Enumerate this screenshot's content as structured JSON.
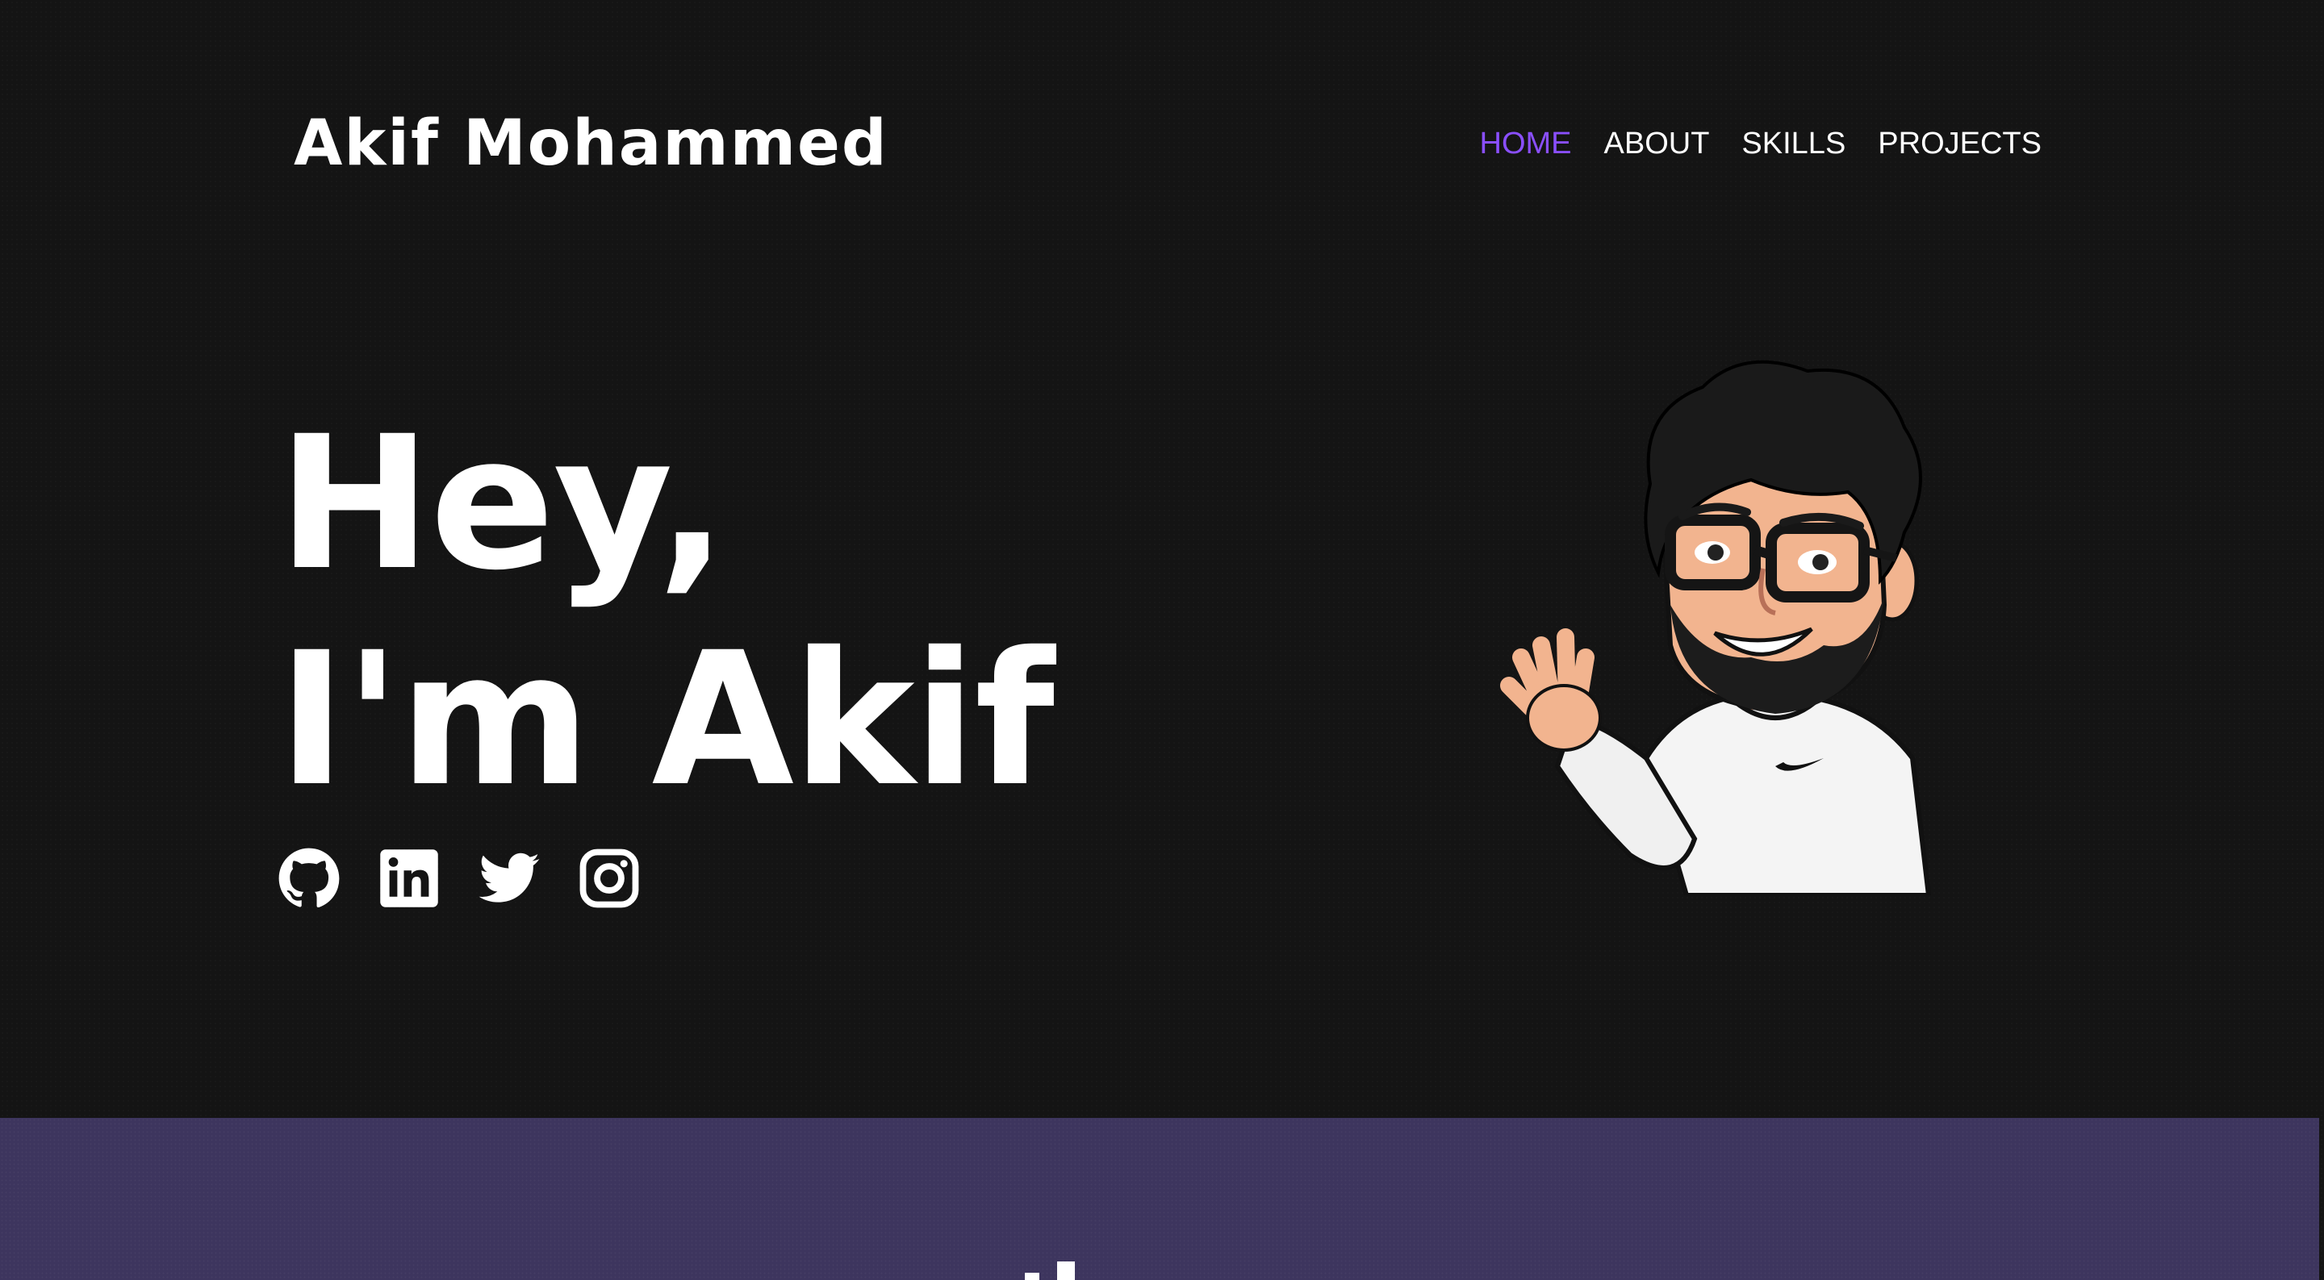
{
  "header": {
    "brand": "Akif Mohammed",
    "nav": [
      {
        "label": "HOME",
        "active": true
      },
      {
        "label": "ABOUT",
        "active": false
      },
      {
        "label": "SKILLS",
        "active": false
      },
      {
        "label": "PROJECTS",
        "active": false
      }
    ]
  },
  "hero": {
    "line1": "Hey,",
    "line2": "I'm Akif",
    "socials": [
      "github-icon",
      "linkedin-icon",
      "twitter-icon",
      "instagram-icon"
    ],
    "avatar": "waving-memoji-avatar"
  },
  "colors": {
    "background": "#141414",
    "accent": "#8a4fff",
    "band": "#3d355e",
    "text": "#ffffff"
  }
}
